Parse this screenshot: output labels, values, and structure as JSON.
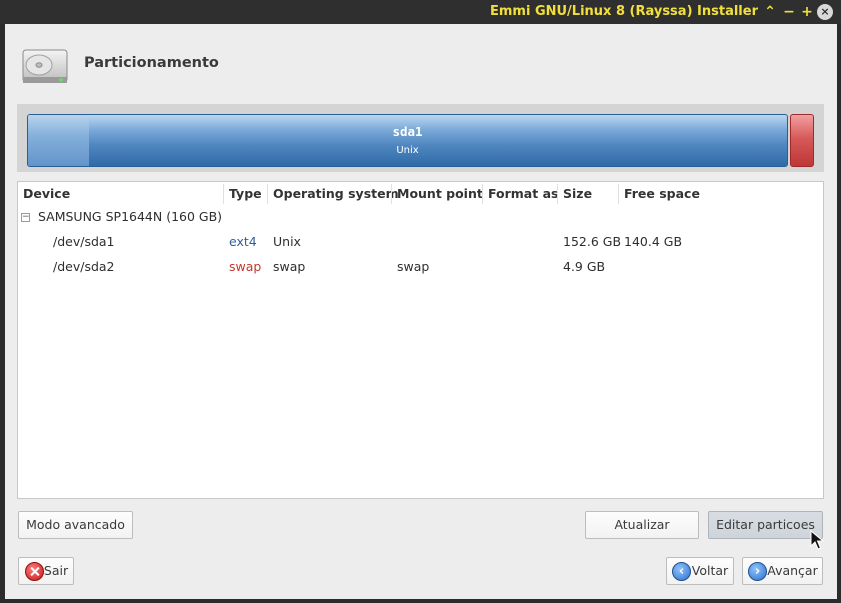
{
  "window": {
    "title": "Emmi GNU/Linux 8 (Rayssa) Installer",
    "controls": {
      "up": "⌃",
      "minimize": "−",
      "maximize": "+",
      "close": "×"
    }
  },
  "page": {
    "title": "Particionamento"
  },
  "partition_bar": {
    "name": "sda1",
    "filesystem": "Unix",
    "used_fraction": 0.08,
    "colors": {
      "main": "#4f86c0",
      "swap": "#d65a5a"
    }
  },
  "table": {
    "headers": {
      "device": "Device",
      "type": "Type",
      "os": "Operating system",
      "mount": "Mount point",
      "format": "Format as",
      "size": "Size",
      "free": "Free space"
    },
    "disk": {
      "label": "SAMSUNG SP1644N (160 GB)",
      "expander": "−"
    },
    "rows": [
      {
        "device": "/dev/sda1",
        "type": "ext4",
        "os": "Unix",
        "mount": "",
        "format": "",
        "size": "152.6 GB",
        "free": "140.4 GB"
      },
      {
        "device": "/dev/sda2",
        "type": "swap",
        "os": "swap",
        "mount": "swap",
        "format": "",
        "size": "4.9 GB",
        "free": ""
      }
    ]
  },
  "buttons": {
    "advanced": "Modo avancado",
    "refresh": "Atualizar",
    "edit": "Editar particoes",
    "quit": "Sair",
    "back": "Voltar",
    "next": "Avançar"
  }
}
